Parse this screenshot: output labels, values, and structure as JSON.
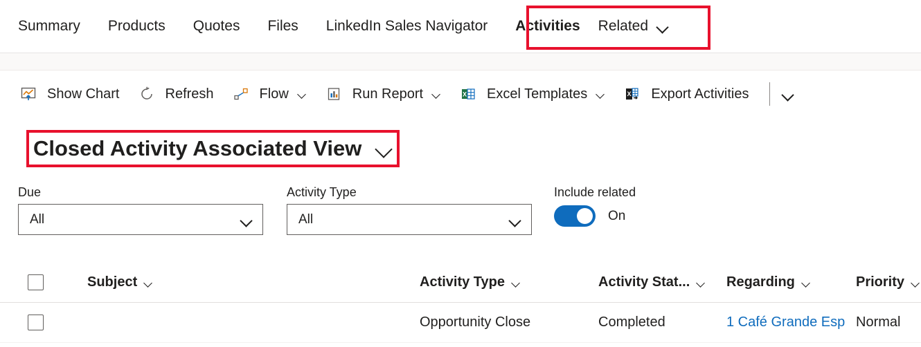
{
  "tabs": [
    {
      "label": "Summary",
      "selected": false
    },
    {
      "label": "Products",
      "selected": false
    },
    {
      "label": "Quotes",
      "selected": false
    },
    {
      "label": "Files",
      "selected": false
    },
    {
      "label": "LinkedIn Sales Navigator",
      "selected": false
    },
    {
      "label": "Activities",
      "selected": true
    }
  ],
  "related_tab": {
    "label": "Related"
  },
  "commandbar": {
    "items": [
      {
        "label": "Show Chart",
        "icon": "chart-icon",
        "has_chevron": false
      },
      {
        "label": "Refresh",
        "icon": "refresh-icon",
        "has_chevron": false
      },
      {
        "label": "Flow",
        "icon": "flow-icon",
        "has_chevron": true
      },
      {
        "label": "Run Report",
        "icon": "report-icon",
        "has_chevron": true
      },
      {
        "label": "Excel Templates",
        "icon": "excel-icon",
        "has_chevron": true
      },
      {
        "label": "Export Activities",
        "icon": "excel-export-icon",
        "has_chevron": false
      }
    ],
    "overflow_label": "More commands"
  },
  "view_selector": {
    "title": "Closed Activity Associated View"
  },
  "filters": {
    "due": {
      "label": "Due",
      "value": "All"
    },
    "activity_type": {
      "label": "Activity Type",
      "value": "All"
    },
    "include_related": {
      "label": "Include related",
      "state": "On"
    }
  },
  "grid": {
    "columns": [
      {
        "label": "Subject"
      },
      {
        "label": "Activity Type"
      },
      {
        "label": "Activity Stat..."
      },
      {
        "label": "Regarding"
      },
      {
        "label": "Priority"
      }
    ],
    "rows": [
      {
        "subject": "",
        "activity_type": "Opportunity Close",
        "activity_status": "Completed",
        "regarding": "1 Café Grande Esp",
        "priority": "Normal"
      }
    ]
  },
  "colors": {
    "accent": "#0f6cbd",
    "annotation": "#e8112d",
    "text": "#201f1e",
    "border": "#605e5c"
  }
}
